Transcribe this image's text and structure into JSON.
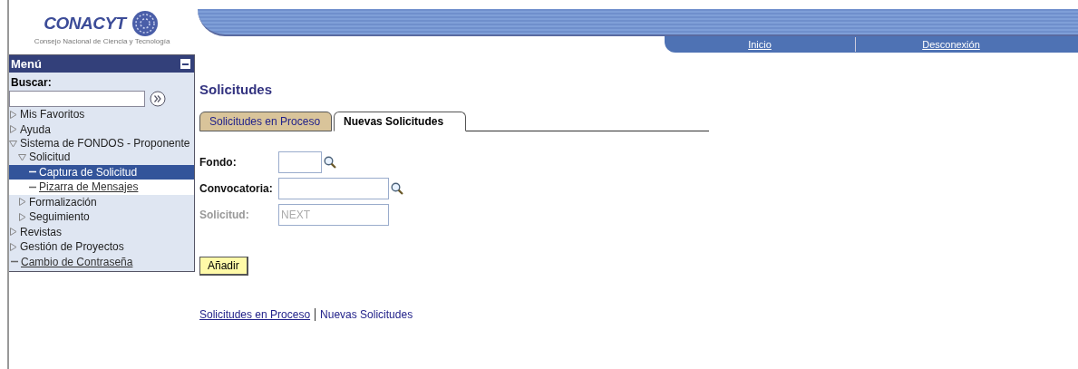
{
  "logo": {
    "name": "CONACYT",
    "subtitle": "Consejo Nacional de Ciencia y Tecnología"
  },
  "header_links": [
    {
      "label": "Inicio"
    },
    {
      "label": "Desconexión"
    }
  ],
  "menu": {
    "title": "Menú",
    "search_label": "Buscar:",
    "items": [
      {
        "label": "Mis Favoritos",
        "kind": "folder",
        "expanded": false
      },
      {
        "label": "Ayuda",
        "kind": "folder",
        "expanded": false
      },
      {
        "label": "Sistema de FONDOS - Proponente",
        "kind": "folder",
        "expanded": true,
        "children": [
          {
            "label": "Solicitud",
            "kind": "folder",
            "expanded": true,
            "children": [
              {
                "label": "Captura de Solicitud",
                "kind": "link",
                "selected": true
              },
              {
                "label": "Pizarra de Mensajes",
                "kind": "link",
                "selected": false
              }
            ]
          },
          {
            "label": "Formalización",
            "kind": "folder",
            "expanded": false
          },
          {
            "label": "Seguimiento",
            "kind": "folder",
            "expanded": false
          }
        ]
      },
      {
        "label": "Revistas",
        "kind": "folder",
        "expanded": false
      },
      {
        "label": "Gestión de Proyectos",
        "kind": "folder",
        "expanded": false
      },
      {
        "label": "Cambio de Contraseña",
        "kind": "link",
        "selected": false
      }
    ]
  },
  "page_title": "Solicitudes",
  "tabs": [
    {
      "label": "Solicitudes en Proceso",
      "selected": false
    },
    {
      "label": "Nuevas Solicitudes",
      "selected": true
    }
  ],
  "fields": [
    {
      "label": "Fondo:",
      "kind": "code",
      "lookup": true,
      "disabled": false
    },
    {
      "label": "Convocatoria:",
      "kind": "text",
      "lookup": true,
      "disabled": false
    },
    {
      "label": "Solicitud:",
      "kind": "text",
      "lookup": false,
      "disabled": true,
      "value": "NEXT"
    }
  ],
  "add_button": "Añadir",
  "footer_links": [
    {
      "label": "Solicitudes en Proceso",
      "underlined": true
    },
    {
      "label": "Nuevas Solicitudes",
      "underlined": false
    }
  ]
}
